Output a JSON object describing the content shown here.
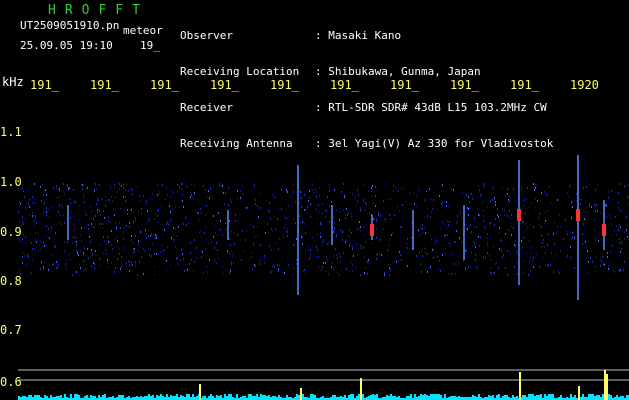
{
  "header": {
    "logo": "HROFFT",
    "filename": "UT2509051910.pn",
    "meteor_word": "meteor",
    "datetime": "25.09.05 19:10",
    "counter": "19_",
    "labels": [
      "Observer",
      "Receiving Location",
      "Receiver",
      "Receiving Antenna"
    ],
    "values": [
      ": Masaki Kano",
      ": Shibukawa, Gunma, Japan",
      ": RTL-SDR SDR# 43dB L15 103.2MHz CW",
      ": 3el Yagi(V) Az 330 for Vladivostok"
    ]
  },
  "axes": {
    "unit": "kHz",
    "time_ticks": [
      "191_",
      "191_",
      "191_",
      "191_",
      "191_",
      "191_",
      "191_",
      "191_",
      "191_",
      "1920"
    ],
    "freq_ticks": [
      "1.1",
      "1.0",
      "0.9",
      "0.8",
      "0.7",
      "0.6"
    ]
  },
  "colors": {
    "logo": "#33cc33",
    "text": "#ffffff",
    "tick": "#ffff66",
    "background": "#000000",
    "noise": "#1a2bc8",
    "signal": "#ff3333",
    "baseline": "#00e5ff"
  }
}
